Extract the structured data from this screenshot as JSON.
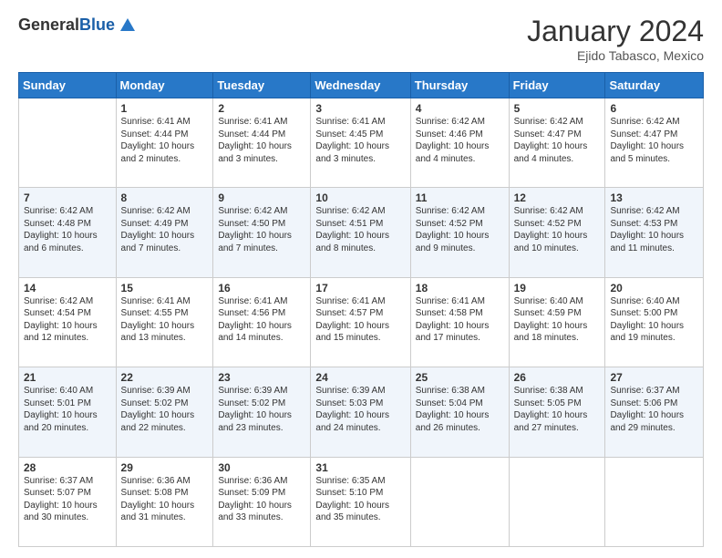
{
  "logo": {
    "general": "General",
    "blue": "Blue"
  },
  "header": {
    "month": "January 2024",
    "location": "Ejido Tabasco, Mexico"
  },
  "days_header": [
    "Sunday",
    "Monday",
    "Tuesday",
    "Wednesday",
    "Thursday",
    "Friday",
    "Saturday"
  ],
  "weeks": [
    [
      {
        "day": "",
        "info": ""
      },
      {
        "day": "1",
        "info": "Sunrise: 6:41 AM\nSunset: 4:44 PM\nDaylight: 10 hours\nand 2 minutes."
      },
      {
        "day": "2",
        "info": "Sunrise: 6:41 AM\nSunset: 4:44 PM\nDaylight: 10 hours\nand 3 minutes."
      },
      {
        "day": "3",
        "info": "Sunrise: 6:41 AM\nSunset: 4:45 PM\nDaylight: 10 hours\nand 3 minutes."
      },
      {
        "day": "4",
        "info": "Sunrise: 6:42 AM\nSunset: 4:46 PM\nDaylight: 10 hours\nand 4 minutes."
      },
      {
        "day": "5",
        "info": "Sunrise: 6:42 AM\nSunset: 4:47 PM\nDaylight: 10 hours\nand 4 minutes."
      },
      {
        "day": "6",
        "info": "Sunrise: 6:42 AM\nSunset: 4:47 PM\nDaylight: 10 hours\nand 5 minutes."
      }
    ],
    [
      {
        "day": "7",
        "info": "Sunrise: 6:42 AM\nSunset: 4:48 PM\nDaylight: 10 hours\nand 6 minutes."
      },
      {
        "day": "8",
        "info": "Sunrise: 6:42 AM\nSunset: 4:49 PM\nDaylight: 10 hours\nand 7 minutes."
      },
      {
        "day": "9",
        "info": "Sunrise: 6:42 AM\nSunset: 4:50 PM\nDaylight: 10 hours\nand 7 minutes."
      },
      {
        "day": "10",
        "info": "Sunrise: 6:42 AM\nSunset: 4:51 PM\nDaylight: 10 hours\nand 8 minutes."
      },
      {
        "day": "11",
        "info": "Sunrise: 6:42 AM\nSunset: 4:52 PM\nDaylight: 10 hours\nand 9 minutes."
      },
      {
        "day": "12",
        "info": "Sunrise: 6:42 AM\nSunset: 4:52 PM\nDaylight: 10 hours\nand 10 minutes."
      },
      {
        "day": "13",
        "info": "Sunrise: 6:42 AM\nSunset: 4:53 PM\nDaylight: 10 hours\nand 11 minutes."
      }
    ],
    [
      {
        "day": "14",
        "info": "Sunrise: 6:42 AM\nSunset: 4:54 PM\nDaylight: 10 hours\nand 12 minutes."
      },
      {
        "day": "15",
        "info": "Sunrise: 6:41 AM\nSunset: 4:55 PM\nDaylight: 10 hours\nand 13 minutes."
      },
      {
        "day": "16",
        "info": "Sunrise: 6:41 AM\nSunset: 4:56 PM\nDaylight: 10 hours\nand 14 minutes."
      },
      {
        "day": "17",
        "info": "Sunrise: 6:41 AM\nSunset: 4:57 PM\nDaylight: 10 hours\nand 15 minutes."
      },
      {
        "day": "18",
        "info": "Sunrise: 6:41 AM\nSunset: 4:58 PM\nDaylight: 10 hours\nand 17 minutes."
      },
      {
        "day": "19",
        "info": "Sunrise: 6:40 AM\nSunset: 4:59 PM\nDaylight: 10 hours\nand 18 minutes."
      },
      {
        "day": "20",
        "info": "Sunrise: 6:40 AM\nSunset: 5:00 PM\nDaylight: 10 hours\nand 19 minutes."
      }
    ],
    [
      {
        "day": "21",
        "info": "Sunrise: 6:40 AM\nSunset: 5:01 PM\nDaylight: 10 hours\nand 20 minutes."
      },
      {
        "day": "22",
        "info": "Sunrise: 6:39 AM\nSunset: 5:02 PM\nDaylight: 10 hours\nand 22 minutes."
      },
      {
        "day": "23",
        "info": "Sunrise: 6:39 AM\nSunset: 5:02 PM\nDaylight: 10 hours\nand 23 minutes."
      },
      {
        "day": "24",
        "info": "Sunrise: 6:39 AM\nSunset: 5:03 PM\nDaylight: 10 hours\nand 24 minutes."
      },
      {
        "day": "25",
        "info": "Sunrise: 6:38 AM\nSunset: 5:04 PM\nDaylight: 10 hours\nand 26 minutes."
      },
      {
        "day": "26",
        "info": "Sunrise: 6:38 AM\nSunset: 5:05 PM\nDaylight: 10 hours\nand 27 minutes."
      },
      {
        "day": "27",
        "info": "Sunrise: 6:37 AM\nSunset: 5:06 PM\nDaylight: 10 hours\nand 29 minutes."
      }
    ],
    [
      {
        "day": "28",
        "info": "Sunrise: 6:37 AM\nSunset: 5:07 PM\nDaylight: 10 hours\nand 30 minutes."
      },
      {
        "day": "29",
        "info": "Sunrise: 6:36 AM\nSunset: 5:08 PM\nDaylight: 10 hours\nand 31 minutes."
      },
      {
        "day": "30",
        "info": "Sunrise: 6:36 AM\nSunset: 5:09 PM\nDaylight: 10 hours\nand 33 minutes."
      },
      {
        "day": "31",
        "info": "Sunrise: 6:35 AM\nSunset: 5:10 PM\nDaylight: 10 hours\nand 35 minutes."
      },
      {
        "day": "",
        "info": ""
      },
      {
        "day": "",
        "info": ""
      },
      {
        "day": "",
        "info": ""
      }
    ]
  ]
}
